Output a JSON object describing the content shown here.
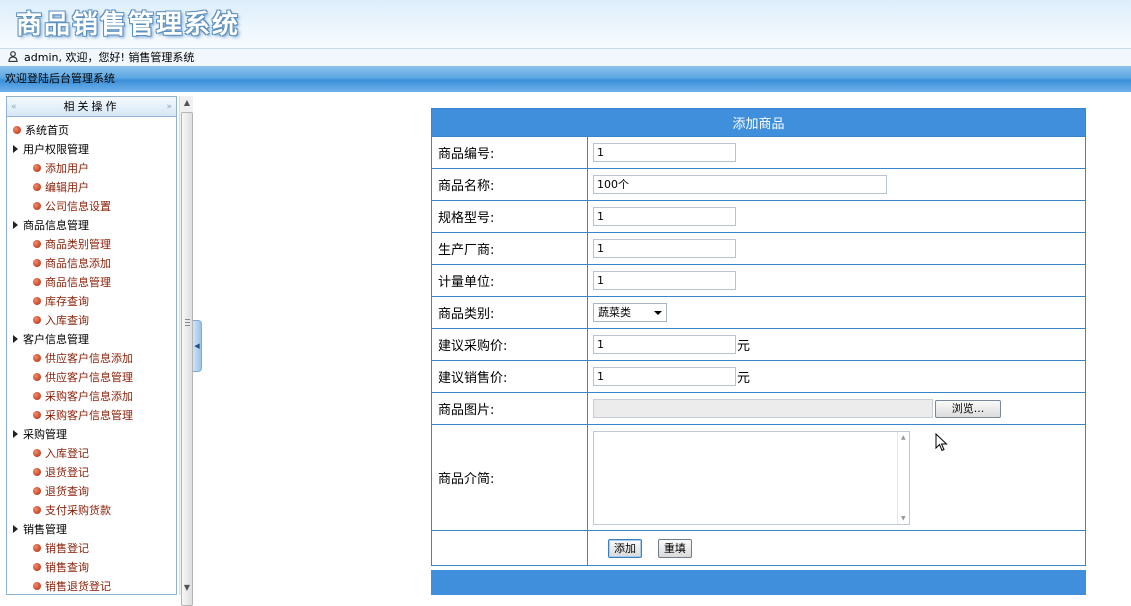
{
  "header": {
    "title": "商品销售管理系统"
  },
  "userbar": {
    "text": "admin, 欢迎，您好! 销售管理系统",
    "icon": "user-icon"
  },
  "welcome": {
    "text": "欢迎登陆后台管理系统"
  },
  "sidebar": {
    "title": "相关操作",
    "items": [
      {
        "label": "系统首页",
        "type": "top"
      },
      {
        "label": "用户权限管理",
        "type": "group"
      },
      {
        "label": "添加用户",
        "type": "sub"
      },
      {
        "label": "编辑用户",
        "type": "sub"
      },
      {
        "label": "公司信息设置",
        "type": "sub"
      },
      {
        "label": "商品信息管理",
        "type": "group"
      },
      {
        "label": "商品类别管理",
        "type": "sub"
      },
      {
        "label": "商品信息添加",
        "type": "sub"
      },
      {
        "label": "商品信息管理",
        "type": "sub"
      },
      {
        "label": "库存查询",
        "type": "sub"
      },
      {
        "label": "入库查询",
        "type": "sub"
      },
      {
        "label": "客户信息管理",
        "type": "group"
      },
      {
        "label": "供应客户信息添加",
        "type": "sub"
      },
      {
        "label": "供应客户信息管理",
        "type": "sub"
      },
      {
        "label": "采购客户信息添加",
        "type": "sub"
      },
      {
        "label": "采购客户信息管理",
        "type": "sub"
      },
      {
        "label": "采购管理",
        "type": "group"
      },
      {
        "label": "入库登记",
        "type": "sub"
      },
      {
        "label": "退货登记",
        "type": "sub"
      },
      {
        "label": "退货查询",
        "type": "sub"
      },
      {
        "label": "支付采购货款",
        "type": "sub"
      },
      {
        "label": "销售管理",
        "type": "group"
      },
      {
        "label": "销售登记",
        "type": "sub"
      },
      {
        "label": "销售查询",
        "type": "sub"
      },
      {
        "label": "销售退货登记",
        "type": "sub"
      }
    ]
  },
  "form": {
    "title": "添加商品",
    "code": {
      "label": "商品编号:",
      "value": "1"
    },
    "name": {
      "label": "商品名称:",
      "value": "100个"
    },
    "spec": {
      "label": "规格型号:",
      "value": "1"
    },
    "maker": {
      "label": "生产厂商:",
      "value": "1"
    },
    "unit": {
      "label": "计量单位:",
      "value": "1"
    },
    "category": {
      "label": "商品类别:",
      "selected": "蔬菜类"
    },
    "buy_price": {
      "label": "建议采购价:",
      "value": "1",
      "unit": "元"
    },
    "sell_price": {
      "label": "建议销售价:",
      "value": "1",
      "unit": "元"
    },
    "image": {
      "label": "商品图片:",
      "browse": "浏览..."
    },
    "intro": {
      "label": "商品介简:",
      "value": ""
    },
    "buttons": {
      "add": "添加",
      "reset": "重填"
    }
  },
  "colors": {
    "accent": "#3f8fdc",
    "border": "#3a84cc",
    "menu_sub_text": "#8a1e06"
  }
}
